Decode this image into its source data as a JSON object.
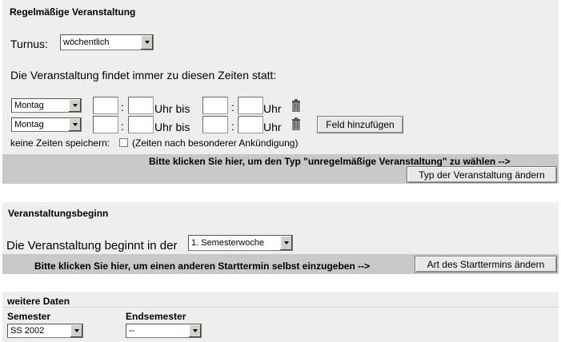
{
  "regular": {
    "title": "Regelmäßige Veranstaltung",
    "turnus_label": "Turnus:",
    "turnus_value": "wöchentlich",
    "intro": "Die Veranstaltung findet immer zu diesen Zeiten statt:",
    "rows": [
      {
        "day": "Montag",
        "colon1": ":",
        "uhr_bis": "Uhr bis",
        "colon2": ":",
        "uhr": "Uhr"
      },
      {
        "day": "Montag",
        "colon1": ":",
        "uhr_bis": "Uhr bis",
        "colon2": ":",
        "uhr": "Uhr"
      }
    ],
    "add_field_button": "Feld hinzufügen",
    "no_times_label": "keine Zeiten speichern:",
    "no_times_note": "(Zeiten nach besonderer Ankündigung)",
    "type_hint": "Bitte klicken Sie hier, um den Typ \"unregelmäßige Veranstaltung\" zu wählen -->",
    "type_button": "Typ der Veranstaltung ändern"
  },
  "begin": {
    "title": "Veranstaltungsbeginn",
    "text": "Die Veranstaltung beginnt in der",
    "week_value": "1. Semesterwoche",
    "hint": "Bitte klicken Sie hier, um einen anderen Starttermin selbst einzugeben -->",
    "button": "Art des Starttermins ändern"
  },
  "further": {
    "title": "weitere Daten",
    "semester_label": "Semester",
    "semester_value": "SS 2002",
    "endsemester_label": "Endsemester",
    "endsemester_value": "--"
  },
  "icons": {
    "trash": "trash-icon",
    "dropdown": "chevron-down-icon"
  }
}
